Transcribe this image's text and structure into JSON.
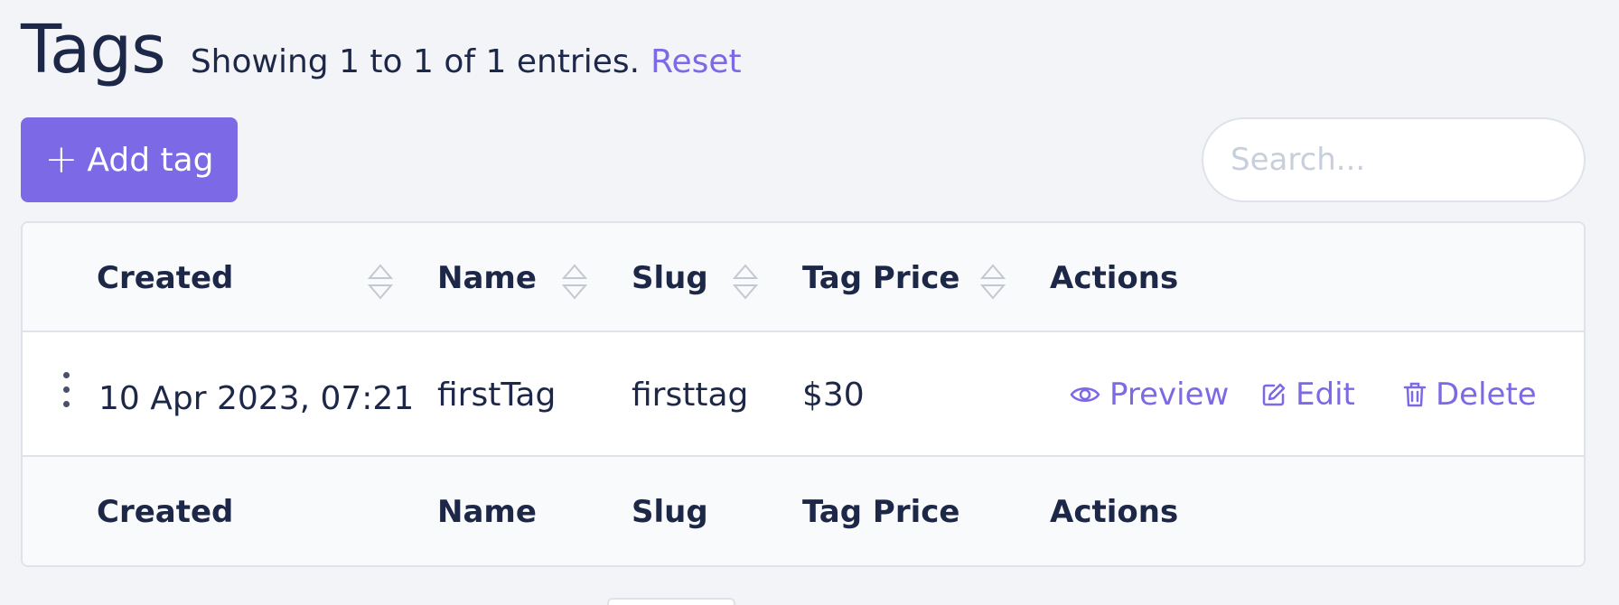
{
  "header": {
    "title": "Tags",
    "summary": "Showing 1 to 1 of 1 entries.",
    "reset_label": "Reset"
  },
  "toolbar": {
    "add_label": "Add tag",
    "add_icon": "plus-icon",
    "search_placeholder": "Search...",
    "search_value": ""
  },
  "table": {
    "columns": [
      "Created",
      "Name",
      "Slug",
      "Tag Price",
      "Actions"
    ],
    "sortable": [
      true,
      true,
      true,
      true,
      false
    ],
    "rows": [
      {
        "created": "10 Apr 2023, 07:21",
        "name": "firstTag",
        "slug": "firsttag",
        "price": "$30",
        "actions": {
          "preview": "Preview",
          "edit": "Edit",
          "delete": "Delete"
        }
      }
    ]
  },
  "colors": {
    "accent": "#7c69e6",
    "text": "#1d2747",
    "background": "#f3f4f8",
    "border": "#dfe2ea"
  }
}
